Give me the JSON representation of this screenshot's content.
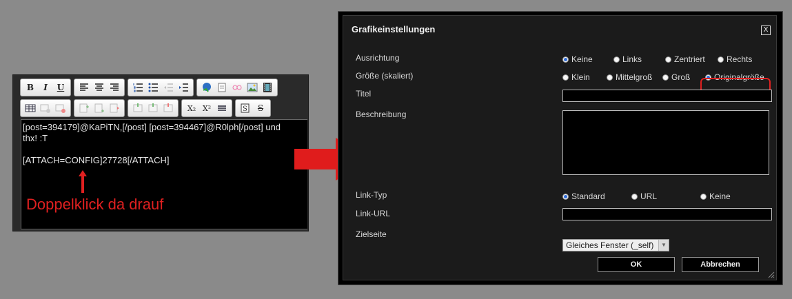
{
  "editor": {
    "toolbar_row1": [
      "bold-icon",
      "italic-icon",
      "underline-icon",
      "align-left-icon",
      "align-center-icon",
      "align-right-icon",
      "ordered-list-icon",
      "unordered-list-icon",
      "outdent-icon",
      "indent-icon",
      "link-icon",
      "unlink-icon",
      "anchor-icon",
      "image-icon",
      "media-icon"
    ],
    "toolbar_row2": [
      "table-icon",
      "table-props-icon",
      "delete-table-icon",
      "insert-row-icon",
      "insert-col-icon",
      "delete-row-icon",
      "cell-icon",
      "split-cell-icon",
      "merge-cell-icon",
      "subscript-icon",
      "superscript-icon",
      "hr-icon",
      "font-icon",
      "strike-icon"
    ],
    "bold_label": "B",
    "italic_label": "I",
    "underline_label": "U",
    "sub_label": "X₂",
    "sup_label": "X²",
    "content_line1": "[post=394179]@KaPiTN,[/post] [post=394467]@R0lph[/post] und",
    "content_line2": "thx! :T",
    "content_line3": "",
    "content_line4": "[ATTACH=CONFIG]27728[/ATTACH]"
  },
  "annotation": {
    "text": "Doppelklick da drauf",
    "color": "#e02020"
  },
  "dialog": {
    "title": "Grafikeinstellungen",
    "close_label": "X",
    "alignment": {
      "label": "Ausrichtung",
      "options": [
        "Keine",
        "Links",
        "Zentriert",
        "Rechts"
      ],
      "selected": "Keine"
    },
    "size": {
      "label": "Größe (skaliert)",
      "options": [
        "Klein",
        "Mittelgroß",
        "Groß",
        "Originalgröße"
      ],
      "selected": "Originalgröße"
    },
    "title_field": {
      "label": "Titel",
      "value": ""
    },
    "description_field": {
      "label": "Beschreibung",
      "value": ""
    },
    "link_type": {
      "label": "Link-Typ",
      "options": [
        "Standard",
        "URL",
        "Keine"
      ],
      "selected": "Standard"
    },
    "link_url": {
      "label": "Link-URL",
      "value": ""
    },
    "target": {
      "label": "Zielseite",
      "value": "Gleiches Fenster (_self)"
    },
    "ok_label": "OK",
    "cancel_label": "Abbrechen"
  }
}
